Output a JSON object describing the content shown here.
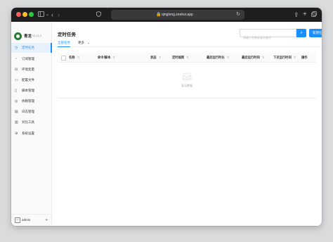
{
  "browser": {
    "url": "qinglong.zeekur.app",
    "colors": {
      "close": "#fe5f57",
      "minimize": "#febc2e",
      "maximize": "#28c840"
    }
  },
  "sidebar": {
    "brand": "青龙",
    "version": "v2.14.2",
    "items": [
      {
        "label": "定时任务",
        "icon": "clock-icon",
        "active": true
      },
      {
        "label": "订阅管理",
        "icon": "subscription-icon"
      },
      {
        "label": "环境变量",
        "icon": "variables-icon"
      },
      {
        "label": "配置文件",
        "icon": "config-file-icon"
      },
      {
        "label": "脚本管理",
        "icon": "script-icon"
      },
      {
        "label": "依赖管理",
        "icon": "dependency-icon"
      },
      {
        "label": "日志管理",
        "icon": "log-icon"
      },
      {
        "label": "对比工具",
        "icon": "diff-icon"
      },
      {
        "label": "系统设置",
        "icon": "settings-icon"
      }
    ],
    "user": {
      "name": "admin"
    }
  },
  "main": {
    "title": "定时任务",
    "search_placeholder": "请输入名称或者关键词",
    "create_button": "新建任务",
    "tabs": [
      {
        "label": "全部任务",
        "active": true
      },
      {
        "label": "更多"
      }
    ],
    "columns": [
      "名称",
      "命令/脚本",
      "状态",
      "定时规则",
      "最后运行时长",
      "最后运行时间",
      "下次运行时间",
      "操作"
    ],
    "empty_text": "暂无数据"
  },
  "accent_color": "#1890ff"
}
